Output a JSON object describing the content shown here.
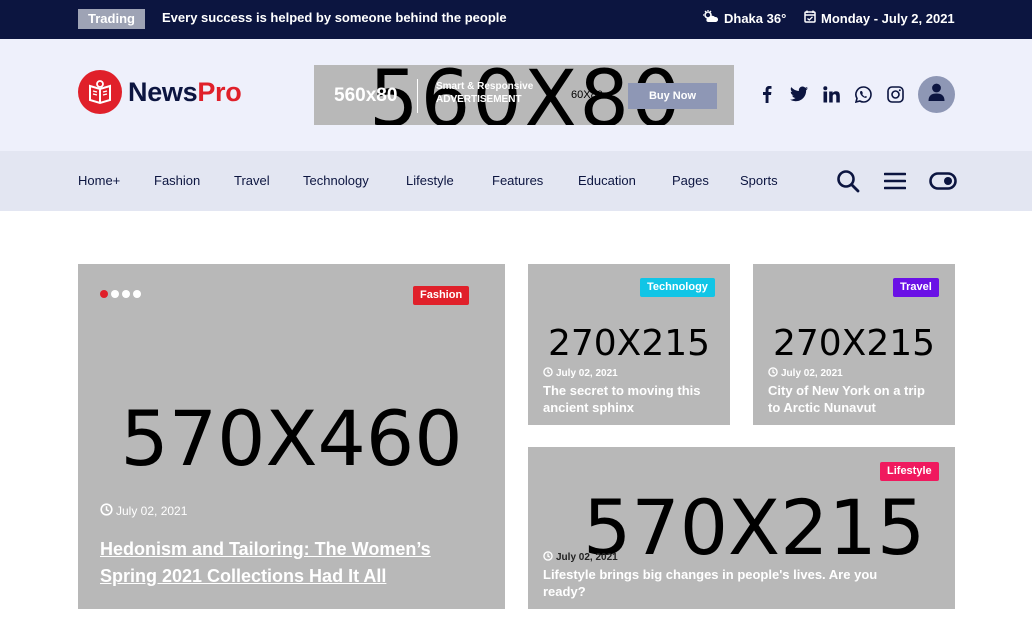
{
  "topbar": {
    "badge": "Trading",
    "ticker": "Every success is helped by someone behind the people",
    "weather": "Dhaka 36°",
    "date": "Monday - July 2, 2021"
  },
  "header": {
    "logo_news": "News",
    "logo_pro": "Pro",
    "ad": {
      "big": "560X80",
      "size": "560x80",
      "line1": "Smart & Responsive",
      "line2": "ADVERTISEMENT",
      "small": "60X80",
      "button": "Buy Now"
    },
    "socials": [
      "facebook-icon",
      "twitter-icon",
      "linkedin-icon",
      "whatsapp-icon",
      "instagram-icon"
    ]
  },
  "nav": {
    "items": [
      "Home+",
      "Fashion",
      "Travel",
      "Technology",
      "Lifestyle",
      "Features",
      "Education",
      "Pages",
      "Sports"
    ]
  },
  "main": {
    "featured": {
      "placeholder": "570X460",
      "category": "Fashion",
      "category_color": "#e0202a",
      "date": "July 02, 2021",
      "title_line1": "Hedonism and Tailoring: The Women’s",
      "title_line2": "Spring 2021 Collections Had It All"
    },
    "card1": {
      "placeholder": "270X215",
      "category": "Technology",
      "category_color": "#11c5e6",
      "date": "July 02, 2021",
      "title_line1": "The secret to moving this",
      "title_line2": "ancient sphinx"
    },
    "card2": {
      "placeholder": "270X215",
      "category": "Travel",
      "category_color": "#6a11e6",
      "date": "July 02, 2021",
      "title_line1": "City of New York on a trip",
      "title_line2": "to Arctic Nunavut"
    },
    "card3": {
      "placeholder": "570X215",
      "category": "Lifestyle",
      "category_color": "#f0195e",
      "date": "July 02, 2021",
      "title_line1": "Lifestyle brings big changes in people's lives. Are you",
      "title_line2": "ready?"
    }
  }
}
